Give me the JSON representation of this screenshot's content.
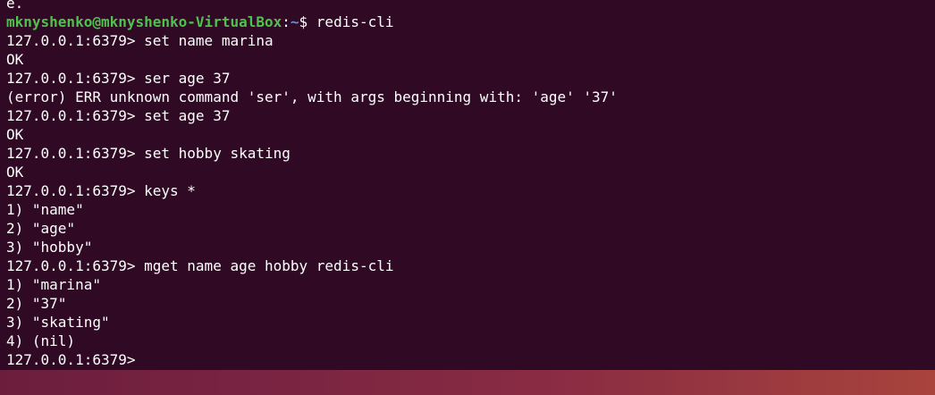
{
  "terminal": {
    "prev_fragment": "e.",
    "prompt": {
      "user_host": "mknyshenko@mknyshenko-VirtualBox",
      "colon": ":",
      "path": "~",
      "symbol": "$ ",
      "command": "redis-cli"
    },
    "lines": [
      "127.0.0.1:6379> set name marina",
      "OK",
      "127.0.0.1:6379> ser age 37",
      "(error) ERR unknown command 'ser', with args beginning with: 'age' '37'",
      "127.0.0.1:6379> set age 37",
      "OK",
      "127.0.0.1:6379> set hobby skating",
      "OK",
      "127.0.0.1:6379> keys *",
      "1) \"name\"",
      "2) \"age\"",
      "3) \"hobby\"",
      "127.0.0.1:6379> mget name age hobby redis-cli",
      "1) \"marina\"",
      "2) \"37\"",
      "3) \"skating\"",
      "4) (nil)",
      "127.0.0.1:6379>"
    ]
  },
  "colors": {
    "background": "#300a24",
    "user_host": "#4fc24d",
    "path": "#6b8fd6",
    "text": "#ffffff"
  }
}
